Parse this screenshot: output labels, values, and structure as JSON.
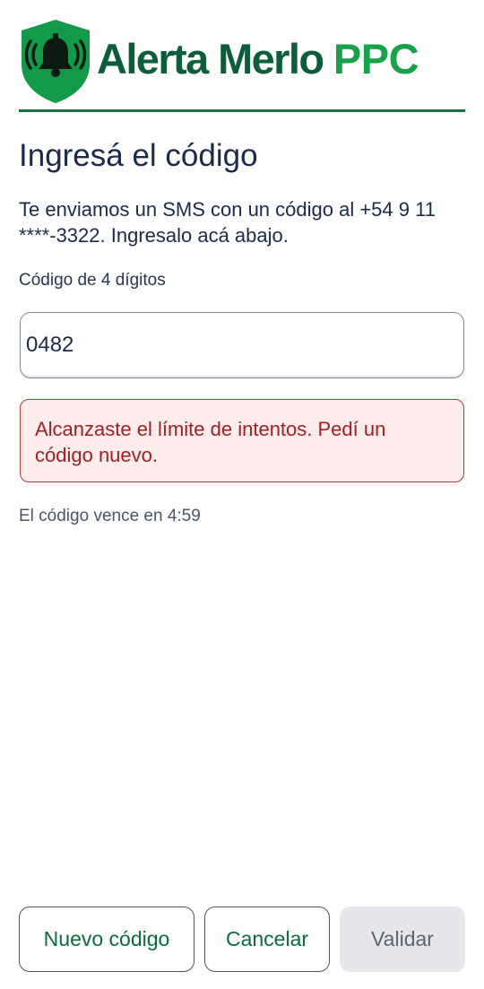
{
  "header": {
    "brand_word1": "Alerta Merlo",
    "brand_word2": "PPC"
  },
  "colors": {
    "brand_dark_green": "#0b5d3b",
    "brand_light_green": "#18a24a",
    "error_bg": "#fdecec",
    "error_text": "#a11f24",
    "disabled_bg": "#e5e7ea"
  },
  "page": {
    "title": "Ingresá el código",
    "description": "Te enviamos un SMS con un código al +54 9 11 ****-3322. Ingresalo acá abajo."
  },
  "form": {
    "code_label": "Código de 4 dígitos",
    "code_value": "0482"
  },
  "alert": {
    "message": "Alcanzaste el límite de intentos. Pedí un código nuevo."
  },
  "expiry_text": "El código vence en 4:59",
  "buttons": {
    "new_code": "Nuevo código",
    "cancel": "Cancelar",
    "validate": "Validar"
  }
}
